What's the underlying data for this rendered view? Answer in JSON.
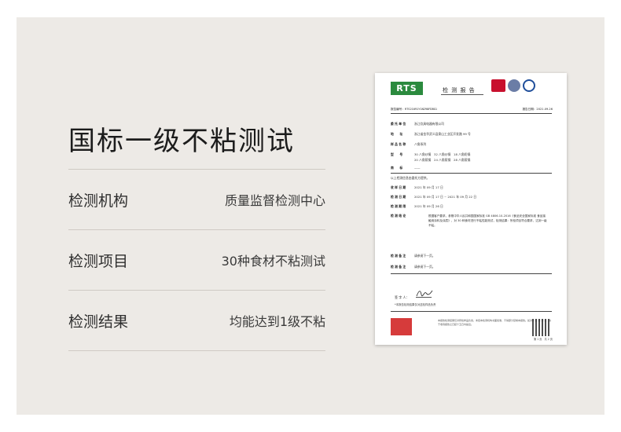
{
  "headline": "国标一级不粘测试",
  "rows": [
    {
      "label": "检测机构",
      "value": "质量监督检测中心"
    },
    {
      "label": "检测项目",
      "value": "30种食材不粘测试"
    },
    {
      "label": "检测结果",
      "value": "均能达到1级不粘"
    }
  ],
  "certificate": {
    "logo": "RTS",
    "title": "检 测 报 告",
    "report_no": "报告编号：RTS21091Y1N298FDBG1",
    "report_date": "报告日期：2021.09.26",
    "fields": [
      {
        "key": "委 托 单 位",
        "value": "浙江炊具电器有限公司"
      },
      {
        "key": "地　　址",
        "value": "浙江省金华武义县泉山工业区开发路 99 号"
      },
      {
        "key": "样 品 名 称",
        "value": "八角系列"
      },
      {
        "key": "型　　号",
        "value": "30 八角炒锅　32 八角炒锅　18 八角奶锅"
      },
      {
        "key": "",
        "value": "20 八角煎锅　24 八角煎锅　28 八角煎锅"
      },
      {
        "key": "商　　标",
        "value": "——"
      }
    ],
    "sample_note": "以上检测信息由委托方提供。",
    "dates": [
      {
        "key": "收 样 日 期",
        "value": "2021 年 09 月 17 日"
      },
      {
        "key": "检 测 日 期",
        "value": "2021 年 09 月 17 日 ~ 2021 年 09 月 22 日"
      },
      {
        "key": "检 测 期 限",
        "value": "2021 年 09 月 26 日"
      },
      {
        "key": "检 测 结 论",
        "value": ""
      }
    ],
    "basis": "根据客户要求，参照中华人民共和国国家标准 GB 4806.10-2016《食品安全国家标准 食品接触用涂料及涂层》，对 30 种食材进行不粘性能测试，检测结果：所检项目符合要求，达到一级不粘。",
    "remarks": [
      {
        "key": "检 测 备 注",
        "value": "请参阅下一页。"
      },
      {
        "key": "检 测 备 注",
        "value": "请参阅下一页。"
      }
    ],
    "signer_label": "签 字 人：",
    "signer_note": "*本报告检测结果仅对送检样品负责",
    "fine_print": "本报告检测结果仅对所检样品负责，未经本检测机构书面批准，不得部分复制本报告。如对本报告有异议，请于收到报告之日起十五日内提出。",
    "page_no": "第 1 页　共 2 页",
    "colors": {
      "logo": "#2b8a3e",
      "ma_mark": "#c8102e",
      "cnas_mark": "#1f4e9a"
    }
  }
}
